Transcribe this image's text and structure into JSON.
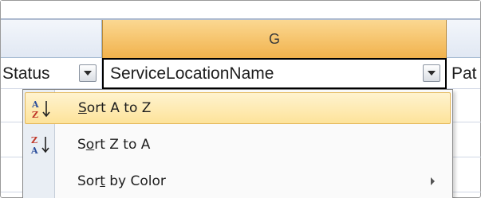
{
  "column_header": {
    "g_label": "G"
  },
  "header_cells": {
    "status": "Status",
    "service_location_name": "ServiceLocationName",
    "next": "Pat"
  },
  "menu": {
    "items": [
      {
        "label": "Sort A to Z",
        "mnemonic_index": 0,
        "icon": "sort-ascending-icon",
        "highlighted": true
      },
      {
        "label": "Sort Z to A",
        "mnemonic_index": 1,
        "icon": "sort-descending-icon",
        "highlighted": false
      },
      {
        "label": "Sort by Color",
        "mnemonic_index": 3,
        "icon": "",
        "has_submenu": true,
        "highlighted": false
      }
    ]
  },
  "colors": {
    "selected_column_header": "#f1b24c",
    "menu_highlight": "#fde39a",
    "menu_gutter": "#e9eef4",
    "icon_red": "#c0392b",
    "icon_blue": "#2a4d9b"
  }
}
